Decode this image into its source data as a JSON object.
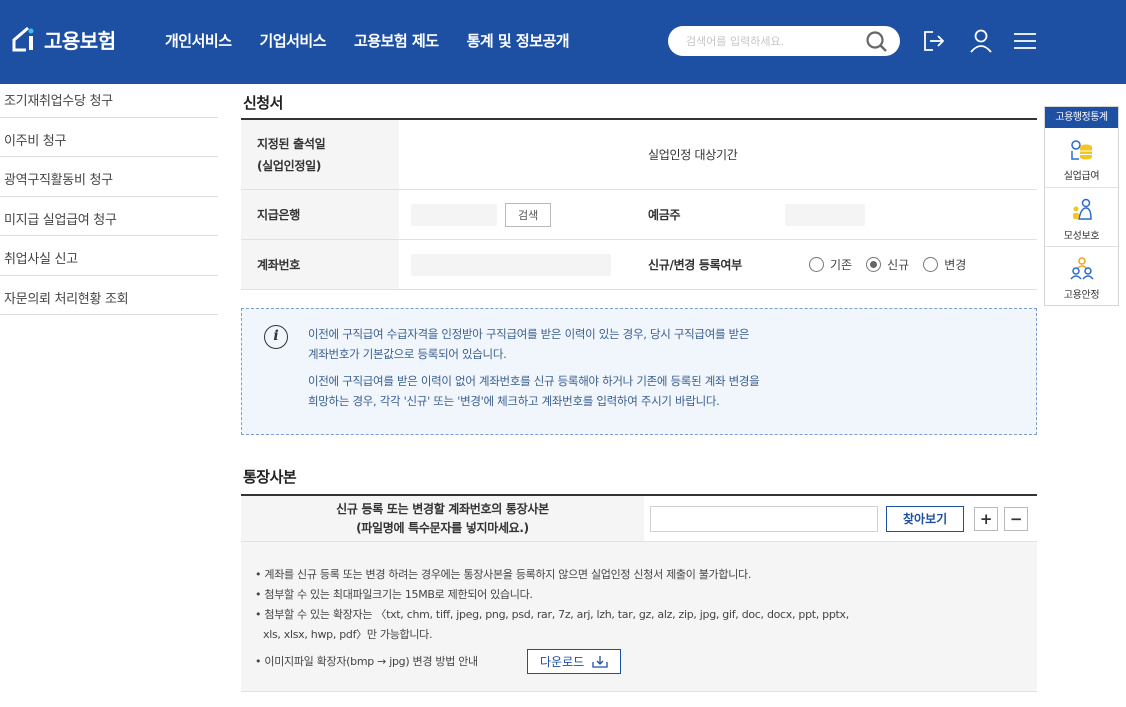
{
  "header": {
    "logo_text": "고용보험",
    "nav": [
      "개인서비스",
      "기업서비스",
      "고용보험 제도",
      "통계 및 정보공개"
    ],
    "search_placeholder": "검색어를 입력하세요.",
    "brand_color": "#1d4fa3"
  },
  "sidebar": {
    "items": [
      "조기재취업수당 청구",
      "이주비 청구",
      "광역구직활동비 청구",
      "미지급 실업급여 청구",
      "취업사실 신고",
      "자문의뢰 처리현황 조회"
    ]
  },
  "application": {
    "title": "신청서",
    "designated_date_label_1": "지정된 출석일",
    "designated_date_label_2": "(실업인정일)",
    "period_label": "실업인정 대상기간",
    "bank_label": "지급은행",
    "search_button": "검색",
    "depositor_label": "예금주",
    "account_label": "계좌번호",
    "registration_label": "신규/변경 등록여부",
    "radio_options": [
      {
        "label": "기존",
        "checked": false
      },
      {
        "label": "신규",
        "checked": true
      },
      {
        "label": "변경",
        "checked": false
      }
    ]
  },
  "info": {
    "lines": [
      "이전에 구직급여 수급자격을 인정받아 구직급여를 받은 이력이 있는 경우, 당시 구직급여를 받은",
      "계좌번호가 기본값으로 등록되어 있습니다.",
      "이전에 구직급여를 받은 이력이 없어 계좌번호를 신규 등록해야 하거나 기존에 등록된 계좌 변경을",
      "희망하는 경우, 각각 '신규' 또는 '변경'에 체크하고 계좌번호를 입력하여 주시기 바랍니다."
    ]
  },
  "bankbook": {
    "title": "통장사본",
    "label_1": "신규 등록 또는 변경할 계좌번호의 통장사본",
    "label_2": "(파일명에 특수문자를 넣지마세요.)",
    "find_button": "찾아보기",
    "add_button": "+",
    "remove_button": "−",
    "notes": [
      "• 계좌를 신규 등록 또는 변경 하려는 경우에는 통장사본을 등록하지 않으면 실업인정 신청서 제출이 불가합니다.",
      "• 첨부할 수 있는 최대파일크기는 15MB로 제한되어 있습니다.",
      "• 첨부할 수 있는 확장자는 〈txt, chm, tiff, jpeg, png, psd, rar, 7z, arj, lzh, tar, gz, alz, zip, jpg, gif, doc, docx, ppt, pptx,",
      "xls, xlsx, hwp, pdf〉만 가능합니다.",
      "• 이미지파일 확장자(bmp → jpg) 변경 방법 안내"
    ],
    "download_button": "다운로드"
  },
  "quick": {
    "title": "고용행정통계",
    "items": [
      "실업급여",
      "모성보호",
      "고용안정"
    ]
  }
}
